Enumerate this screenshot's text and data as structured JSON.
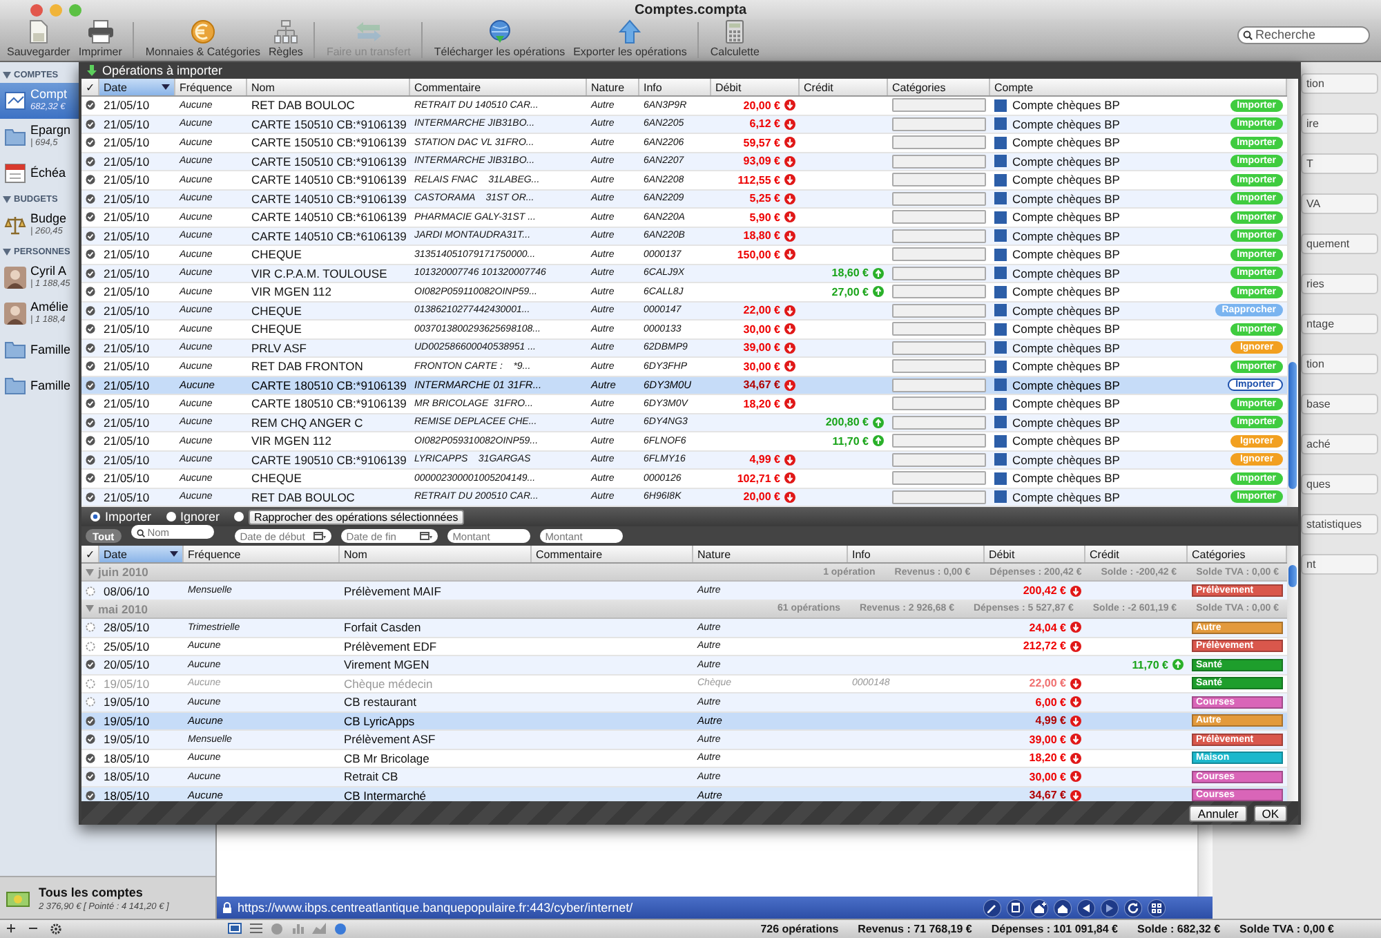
{
  "window": {
    "title": "Comptes.compta"
  },
  "toolbar": {
    "items": [
      {
        "label": "Sauvegarder",
        "kind": "save",
        "disabled": false
      },
      {
        "label": "Imprimer",
        "kind": "print",
        "disabled": false
      },
      {
        "label": "Monnaies & Catégories",
        "kind": "currency",
        "disabled": false
      },
      {
        "label": "Règles",
        "kind": "rules",
        "disabled": false
      },
      {
        "label": "Faire un transfert",
        "kind": "transfer",
        "disabled": true
      },
      {
        "label": "Télécharger les opérations",
        "kind": "download",
        "disabled": false
      },
      {
        "label": "Exporter les opérations",
        "kind": "export",
        "disabled": false
      },
      {
        "label": "Calculette",
        "kind": "calculator",
        "disabled": false
      }
    ],
    "search": {
      "placeholder": "Recherche"
    }
  },
  "sidebar": {
    "sections": [
      {
        "title": "COMPTES",
        "items": [
          {
            "name": "Compt",
            "amount": "682,32 €",
            "kind": "bank",
            "selected": true
          },
          {
            "name": "Epargn",
            "amount": "| 694,5",
            "kind": "folder",
            "selected": false
          },
          {
            "name": "Échéa",
            "kind": "calendar",
            "selected": false
          }
        ]
      },
      {
        "title": "BUDGETS",
        "items": [
          {
            "name": "Budge",
            "amount": "| 260,45",
            "kind": "scale",
            "selected": false
          }
        ]
      },
      {
        "title": "PERSONNES",
        "items": [
          {
            "name": "Cyril A",
            "amount": "| 1 188,45",
            "kind": "person",
            "selected": false
          },
          {
            "name": "Amélie",
            "amount": "| 1 188,4",
            "kind": "person",
            "selected": false
          },
          {
            "name": "Famille",
            "kind": "folder",
            "selected": false
          },
          {
            "name": "Famille",
            "kind": "folder",
            "selected": false
          }
        ]
      }
    ],
    "total": {
      "name": "Tous les comptes",
      "amount": "2 376,90 € [ Pointé : 4 141,20 € ]"
    }
  },
  "right_panel": {
    "fragments": [
      "tion",
      "ire",
      "T",
      "VA",
      "quement",
      "ries",
      "ntage",
      "tion",
      "base",
      "aché",
      "ques",
      "statistiques",
      "nt"
    ]
  },
  "import_sheet": {
    "title": "Opérations à importer",
    "columns": [
      {
        "label": "✓",
        "sorted": false
      },
      {
        "label": "Date",
        "sorted": true
      },
      {
        "label": "Fréquence",
        "sorted": false
      },
      {
        "label": "Nom",
        "sorted": false
      },
      {
        "label": "Commentaire",
        "sorted": false
      },
      {
        "label": "Nature",
        "sorted": false
      },
      {
        "label": "Info",
        "sorted": false
      },
      {
        "label": "Débit",
        "sorted": false
      },
      {
        "label": "Crédit",
        "sorted": false
      },
      {
        "label": "Catégories",
        "sorted": false
      },
      {
        "label": "Compte",
        "sorted": false
      }
    ],
    "rows": [
      {
        "date": "21/05/10",
        "frequency": "Aucune",
        "name": "RET DAB BOULOC",
        "comment": "RETRAIT DU 140510 CAR...",
        "nature": "Autre",
        "info": "6AN3P9R",
        "debit": "20,00 €",
        "account": "Compte chèques BP",
        "action": {
          "label": "Importer",
          "kind": "import"
        },
        "selected": false
      },
      {
        "date": "21/05/10",
        "frequency": "Aucune",
        "name": "CARTE 150510 CB:*9106139",
        "comment": "INTERMARCHE JIB31BO...",
        "nature": "Autre",
        "info": "6AN2205",
        "debit": "6,12 €",
        "account": "Compte chèques BP",
        "action": {
          "label": "Importer",
          "kind": "import"
        },
        "selected": false
      },
      {
        "date": "21/05/10",
        "frequency": "Aucune",
        "name": "CARTE 150510 CB:*9106139",
        "comment": "STATION DAC VL 31FRO...",
        "nature": "Autre",
        "info": "6AN2206",
        "debit": "59,57 €",
        "account": "Compte chèques BP",
        "action": {
          "label": "Importer",
          "kind": "import"
        },
        "selected": false
      },
      {
        "date": "21/05/10",
        "frequency": "Aucune",
        "name": "CARTE 150510 CB:*9106139",
        "comment": "INTERMARCHE JIB31BO...",
        "nature": "Autre",
        "info": "6AN2207",
        "debit": "93,09 €",
        "account": "Compte chèques BP",
        "action": {
          "label": "Importer",
          "kind": "import"
        },
        "selected": false
      },
      {
        "date": "21/05/10",
        "frequency": "Aucune",
        "name": "CARTE 140510 CB:*9106139",
        "comment": "RELAIS FNAC    31LABEG...",
        "nature": "Autre",
        "info": "6AN2208",
        "debit": "112,55 €",
        "account": "Compte chèques BP",
        "action": {
          "label": "Importer",
          "kind": "import"
        },
        "selected": false
      },
      {
        "date": "21/05/10",
        "frequency": "Aucune",
        "name": "CARTE 140510 CB:*9106139",
        "comment": "CASTORAMA    31ST OR...",
        "nature": "Autre",
        "info": "6AN2209",
        "debit": "5,25 €",
        "account": "Compte chèques BP",
        "action": {
          "label": "Importer",
          "kind": "import"
        },
        "selected": false
      },
      {
        "date": "21/05/10",
        "frequency": "Aucune",
        "name": "CARTE 140510 CB:*6106139",
        "comment": "PHARMACIE GALY-31ST ...",
        "nature": "Autre",
        "info": "6AN220A",
        "debit": "5,90 €",
        "account": "Compte chèques BP",
        "action": {
          "label": "Importer",
          "kind": "import"
        },
        "selected": false
      },
      {
        "date": "21/05/10",
        "frequency": "Aucune",
        "name": "CARTE 140510 CB:*6106139",
        "comment": "JARDI MONTAUDRA31T...",
        "nature": "Autre",
        "info": "6AN220B",
        "debit": "18,80 €",
        "account": "Compte chèques BP",
        "action": {
          "label": "Importer",
          "kind": "import"
        },
        "selected": false
      },
      {
        "date": "21/05/10",
        "frequency": "Aucune",
        "name": "CHEQUE",
        "comment": "313514051079171750000...",
        "nature": "Autre",
        "info": "0000137",
        "debit": "150,00 €",
        "account": "Compte chèques BP",
        "action": {
          "label": "Importer",
          "kind": "import"
        },
        "selected": false
      },
      {
        "date": "21/05/10",
        "frequency": "Aucune",
        "name": "VIR C.P.A.M. TOULOUSE",
        "comment": "101320007746 101320007746",
        "nature": "Autre",
        "info": "6CALJ9X",
        "credit": "18,60 €",
        "account": "Compte chèques BP",
        "action": {
          "label": "Importer",
          "kind": "import"
        },
        "selected": false
      },
      {
        "date": "21/05/10",
        "frequency": "Aucune",
        "name": "VIR MGEN 112",
        "comment": "OI082P059110082OINP59...",
        "nature": "Autre",
        "info": "6CALL8J",
        "credit": "27,00 €",
        "account": "Compte chèques BP",
        "action": {
          "label": "Importer",
          "kind": "import"
        },
        "selected": false
      },
      {
        "date": "21/05/10",
        "frequency": "Aucune",
        "name": "CHEQUE",
        "comment": "01386210277442430001...",
        "nature": "Autre",
        "info": "0000147",
        "debit": "22,00 €",
        "account": "Compte chèques BP",
        "action": {
          "label": "Rapprocher",
          "kind": "reconcile"
        },
        "selected": false
      },
      {
        "date": "21/05/10",
        "frequency": "Aucune",
        "name": "CHEQUE",
        "comment": "0037013800293625698108...",
        "nature": "Autre",
        "info": "0000133",
        "debit": "30,00 €",
        "account": "Compte chèques BP",
        "action": {
          "label": "Importer",
          "kind": "import"
        },
        "selected": false
      },
      {
        "date": "21/05/10",
        "frequency": "Aucune",
        "name": "PRLV ASF",
        "comment": "UD002586600040538951 ...",
        "nature": "Autre",
        "info": "62DBMP9",
        "debit": "39,00 €",
        "account": "Compte chèques BP",
        "action": {
          "label": "Ignorer",
          "kind": "ignore"
        },
        "selected": false
      },
      {
        "date": "21/05/10",
        "frequency": "Aucune",
        "name": "RET DAB FRONTON",
        "comment": "FRONTON CARTE :    *9...",
        "nature": "Autre",
        "info": "6DY3FHP",
        "debit": "30,00 €",
        "account": "Compte chèques BP",
        "action": {
          "label": "Importer",
          "kind": "import"
        },
        "selected": false
      },
      {
        "date": "21/05/10",
        "frequency": "Aucune",
        "name": "CARTE 180510 CB:*9106139",
        "comment": "INTERMARCHE 01 31FR...",
        "nature": "Autre",
        "info": "6DY3M0U",
        "debit": "34,67 €",
        "account": "Compte chèques BP",
        "action": {
          "label": "Importer",
          "kind": "import"
        },
        "selected": true
      },
      {
        "date": "21/05/10",
        "frequency": "Aucune",
        "name": "CARTE 180510 CB:*9106139",
        "comment": "MR BRICOLAGE  31FRO...",
        "nature": "Autre",
        "info": "6DY3M0V",
        "debit": "18,20 €",
        "account": "Compte chèques BP",
        "action": {
          "label": "Importer",
          "kind": "import"
        },
        "selected": false
      },
      {
        "date": "21/05/10",
        "frequency": "Aucune",
        "name": "REM CHQ ANGER C",
        "comment": "REMISE DEPLACEE CHE...",
        "nature": "Autre",
        "info": "6DY4NG3",
        "credit": "200,80 €",
        "account": "Compte chèques BP",
        "action": {
          "label": "Importer",
          "kind": "import"
        },
        "selected": false
      },
      {
        "date": "21/05/10",
        "frequency": "Aucune",
        "name": "VIR MGEN 112",
        "comment": "OI082P059310082OINP59...",
        "nature": "Autre",
        "info": "6FLNOF6",
        "credit": "11,70 €",
        "account": "Compte chèques BP",
        "action": {
          "label": "Ignorer",
          "kind": "ignore"
        },
        "selected": false
      },
      {
        "date": "21/05/10",
        "frequency": "Aucune",
        "name": "CARTE 190510 CB:*9106139",
        "comment": "LYRICAPPS    31GARGAS",
        "nature": "Autre",
        "info": "6FLMY16",
        "debit": "4,99 €",
        "account": "Compte chèques BP",
        "action": {
          "label": "Ignorer",
          "kind": "ignore"
        },
        "selected": false
      },
      {
        "date": "21/05/10",
        "frequency": "Aucune",
        "name": "CHEQUE",
        "comment": "000002300001005204149...",
        "nature": "Autre",
        "info": "0000126",
        "debit": "102,71 €",
        "account": "Compte chèques BP",
        "action": {
          "label": "Importer",
          "kind": "import"
        },
        "selected": false
      },
      {
        "date": "21/05/10",
        "frequency": "Aucune",
        "name": "RET DAB BOULOC",
        "comment": "RETRAIT DU 200510 CAR...",
        "nature": "Autre",
        "info": "6H96I8K",
        "debit": "20,00 €",
        "account": "Compte chèques BP",
        "action": {
          "label": "Importer",
          "kind": "import"
        },
        "selected": false
      }
    ],
    "options": [
      {
        "label": "Importer",
        "kind": "radio",
        "selected": true
      },
      {
        "label": "Ignorer",
        "kind": "radio",
        "selected": false
      },
      {
        "label": "Rapprocher des opérations sélectionnées",
        "kind": "button",
        "selected": false
      }
    ]
  },
  "filters": {
    "all": "Tout",
    "fields": [
      {
        "placeholder": "Nom",
        "kind": "search"
      },
      {
        "placeholder": "Date de début",
        "kind": "date"
      },
      {
        "placeholder": "Date de fin",
        "kind": "date"
      },
      {
        "placeholder": "Montant",
        "kind": "plain"
      },
      {
        "placeholder": "Montant",
        "kind": "plain"
      }
    ]
  },
  "ledger": {
    "columns": [
      {
        "label": "✓",
        "sorted": false
      },
      {
        "label": "Date",
        "sorted": true
      },
      {
        "label": "Fréquence",
        "sorted": false
      },
      {
        "label": "Nom",
        "sorted": false
      },
      {
        "label": "Commentaire",
        "sorted": false
      },
      {
        "label": "Nature",
        "sorted": false
      },
      {
        "label": "Info",
        "sorted": false
      },
      {
        "label": "Débit",
        "sorted": false
      },
      {
        "label": "Crédit",
        "sorted": false
      },
      {
        "label": "Catégories",
        "sorted": false
      }
    ],
    "rows": [
      {
        "kind": "group",
        "label": "juin 2010",
        "expanded": true,
        "summary": [
          "1 opération",
          "Revenus : 0,00 €",
          "Dépenses : 200,42 €",
          "Solde : -200,42 €",
          "Solde TVA : 0,00 €"
        ]
      },
      {
        "kind": "operation",
        "date": "08/06/10",
        "frequency": "Mensuelle",
        "name": "Prélèvement MAIF",
        "nature": "Autre",
        "debit": "200,42 €",
        "category": {
          "label": "Prélèvement",
          "color": "#d9574c"
        },
        "checked": false,
        "selected": false,
        "disabled": false
      },
      {
        "kind": "group",
        "label": "mai 2010",
        "expanded": true,
        "summary": [
          "61 opérations",
          "Revenus : 2 926,68 €",
          "Dépenses : 5 527,87 €",
          "Solde : -2 601,19 €",
          "Solde TVA : 0,00 €"
        ]
      },
      {
        "kind": "operation",
        "date": "28/05/10",
        "frequency": "Trimestrielle",
        "name": "Forfait Casden",
        "nature": "Autre",
        "debit": "24,04 €",
        "category": {
          "label": "Autre",
          "color": "#e39a3c"
        },
        "checked": false,
        "selected": false,
        "disabled": false
      },
      {
        "kind": "operation",
        "date": "25/05/10",
        "frequency": "Aucune",
        "name": "Prélèvement EDF",
        "nature": "Autre",
        "debit": "212,72 €",
        "category": {
          "label": "Prélèvement",
          "color": "#d9574c"
        },
        "checked": false,
        "selected": false,
        "disabled": false
      },
      {
        "kind": "operation",
        "date": "20/05/10",
        "frequency": "Aucune",
        "name": "Virement MGEN",
        "nature": "Autre",
        "credit": "11,70 €",
        "category": {
          "label": "Santé",
          "color": "#1e9e2c"
        },
        "checked": true,
        "selected": false,
        "disabled": false
      },
      {
        "kind": "operation",
        "date": "19/05/10",
        "frequency": "Aucune",
        "name": "Chèque médecin",
        "nature": "Chèque",
        "info": "0000148",
        "debit": "22,00 €",
        "category": {
          "label": "Santé",
          "color": "#1e9e2c"
        },
        "checked": false,
        "selected": false,
        "disabled": true
      },
      {
        "kind": "operation",
        "date": "19/05/10",
        "frequency": "Aucune",
        "name": "CB restaurant",
        "nature": "Autre",
        "debit": "6,00 €",
        "category": {
          "label": "Courses",
          "color": "#d965b8"
        },
        "checked": false,
        "selected": false,
        "disabled": false
      },
      {
        "kind": "operation",
        "date": "19/05/10",
        "frequency": "Aucune",
        "name": "CB LyricApps",
        "nature": "Autre",
        "debit": "4,99 €",
        "category": {
          "label": "Autre",
          "color": "#e39a3c"
        },
        "checked": true,
        "selected": true,
        "disabled": false
      },
      {
        "kind": "operation",
        "date": "19/05/10",
        "frequency": "Mensuelle",
        "name": "Prélèvement ASF",
        "nature": "Autre",
        "debit": "39,00 €",
        "category": {
          "label": "Prélèvement",
          "color": "#d9574c"
        },
        "checked": true,
        "selected": false,
        "disabled": false
      },
      {
        "kind": "operation",
        "date": "18/05/10",
        "frequency": "Aucune",
        "name": "CB Mr Bricolage",
        "nature": "Autre",
        "debit": "18,20 €",
        "category": {
          "label": "Maison",
          "color": "#1bb8cc"
        },
        "checked": true,
        "selected": false,
        "disabled": false
      },
      {
        "kind": "operation",
        "date": "18/05/10",
        "frequency": "Aucune",
        "name": "Retrait CB",
        "nature": "Autre",
        "debit": "30,00 €",
        "category": {
          "label": "Courses",
          "color": "#d965b8"
        },
        "checked": true,
        "selected": false,
        "disabled": false
      },
      {
        "kind": "operation",
        "date": "18/05/10",
        "frequency": "Aucune",
        "name": "CB Intermarché",
        "nature": "Autre",
        "debit": "34,67 €",
        "category": {
          "label": "Courses",
          "color": "#d965b8"
        },
        "checked": true,
        "selected": true,
        "disabled": false
      }
    ]
  },
  "buttons": [
    "Annuler",
    "OK"
  ],
  "browser": {
    "url": "https://www.ibps.centreatlantique.banquepopulaire.fr:443/cyber/internet/"
  },
  "status_bar": {
    "items": [
      "726 opérations",
      "Revenus : 71 768,19 €",
      "Dépenses : 101 091,84 €",
      "Solde : 682,32 €",
      "Solde TVA : 0,00 €"
    ]
  }
}
